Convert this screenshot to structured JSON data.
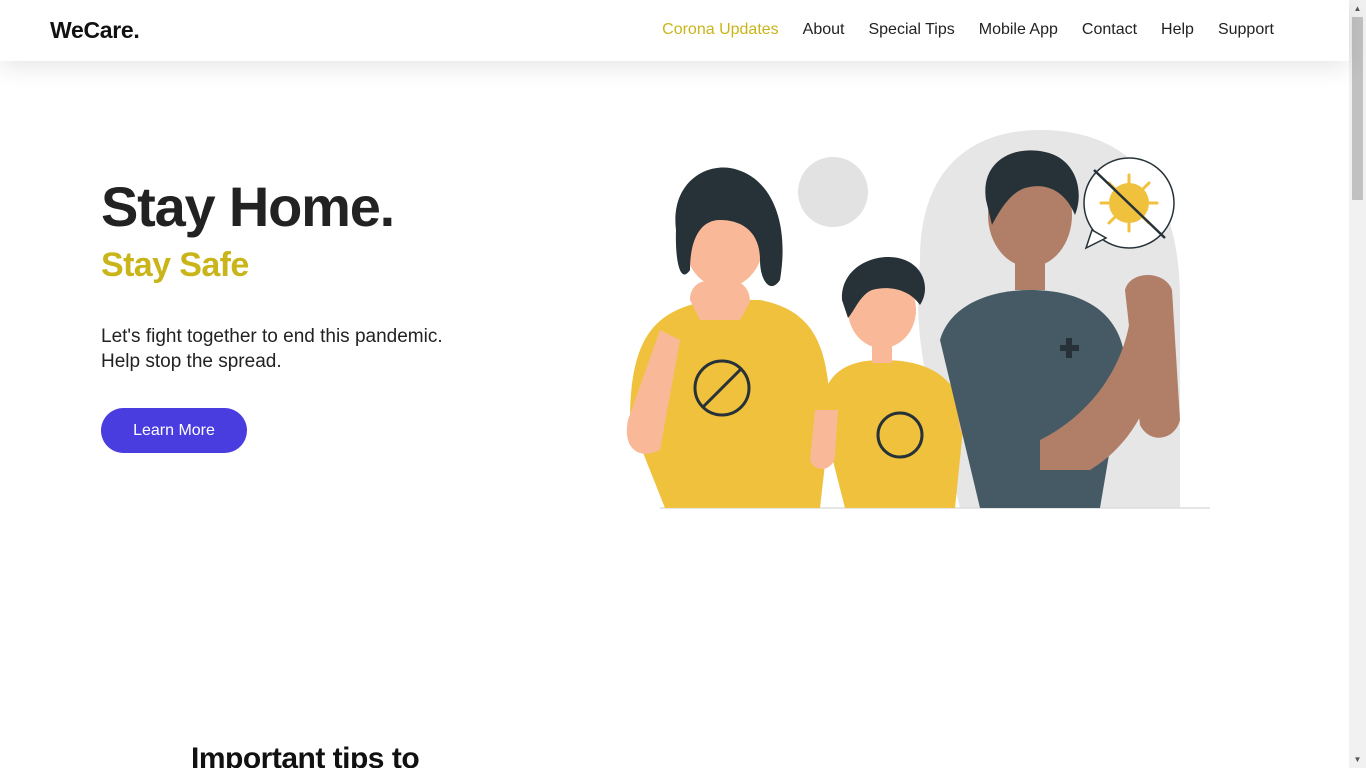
{
  "header": {
    "brand": "WeCare.",
    "nav": [
      {
        "label": "Corona Updates",
        "active": true
      },
      {
        "label": "About",
        "active": false
      },
      {
        "label": "Special Tips",
        "active": false
      },
      {
        "label": "Mobile App",
        "active": false
      },
      {
        "label": "Contact",
        "active": false
      },
      {
        "label": "Help",
        "active": false
      },
      {
        "label": "Support",
        "active": false
      }
    ]
  },
  "hero": {
    "title": "Stay Home.",
    "subtitle": "Stay Safe",
    "text_line1": "Let's fight together to end this pandemic.",
    "text_line2": "Help stop the spread.",
    "cta_label": "Learn More"
  },
  "section": {
    "title": "Important tips to"
  },
  "colors": {
    "accent": "#c9b51a",
    "button": "#4a3de0",
    "text": "#222222"
  },
  "icons": [
    "family-illustration-image",
    "no-virus-icon",
    "scroll-up-arrow-icon",
    "scroll-down-arrow-icon"
  ]
}
